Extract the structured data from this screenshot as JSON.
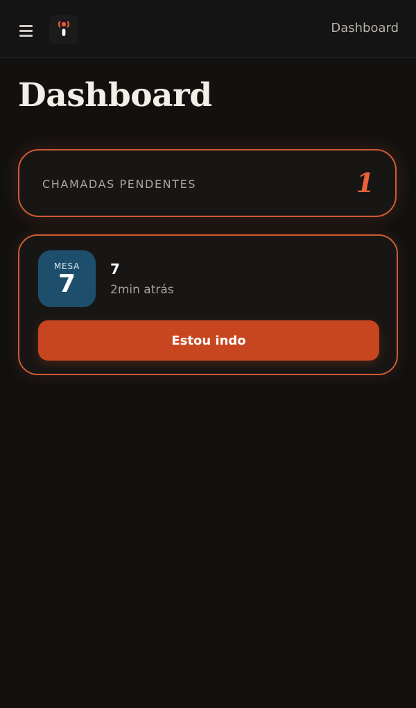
{
  "topbar": {
    "menu_icon": "hamburger-menu-icon",
    "logo_icon": "broadcast-call-icon",
    "title": "Dashboard"
  },
  "page": {
    "title": "Dashboard"
  },
  "pending": {
    "label": "CHAMADAS PENDENTES",
    "count": "1"
  },
  "calls": [
    {
      "table_label": "MESA",
      "table_number": "7",
      "title": "7",
      "time": "2min atrás",
      "action_label": "Estou indo"
    }
  ],
  "colors": {
    "background": "#121110",
    "accent": "#c8461f",
    "accent_border": "#cf5b35",
    "table_badge": "#1d4f6d"
  }
}
